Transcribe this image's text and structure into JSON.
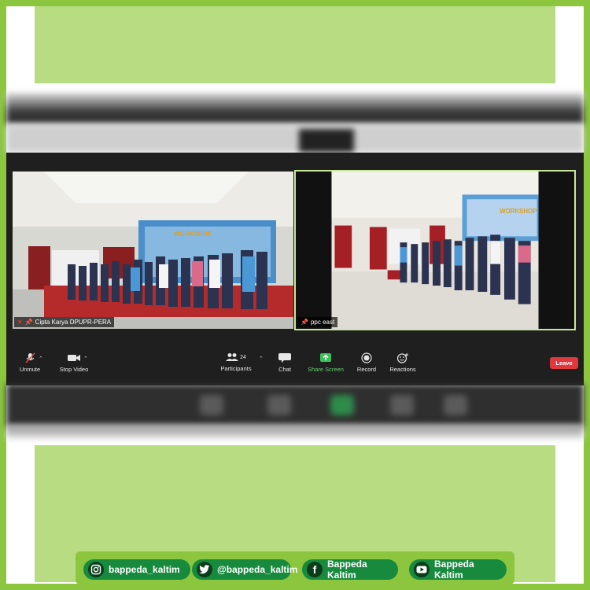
{
  "meeting": {
    "tiles": [
      {
        "name": "Cipta Karya DPUPR-PERA",
        "mic_muted": true
      },
      {
        "name": "ppc east",
        "active_speaker": true
      }
    ]
  },
  "toolbar": {
    "unmute_label": "Unmute",
    "stop_video_label": "Stop Video",
    "participants_label": "Participants",
    "participants_count": "24",
    "chat_label": "Chat",
    "share_screen_label": "Share Screen",
    "record_label": "Record",
    "reactions_label": "Reactions",
    "leave_label": "Leave"
  },
  "banner_text": "WORKSHOP",
  "socials": [
    {
      "icon": "instagram-icon",
      "label": "bappeda_kaltim"
    },
    {
      "icon": "twitter-icon",
      "label": "@bappeda_kaltim"
    },
    {
      "icon": "facebook-icon",
      "label": "Bappeda Kaltim"
    },
    {
      "icon": "youtube-icon",
      "label": "Bappeda Kaltim"
    }
  ],
  "colors": {
    "outer_border": "#8cc63f",
    "light_green": "#b7dc82",
    "pill_green": "#188a3e",
    "share_green": "#5fd36a",
    "leave_red": "#e0383e"
  }
}
